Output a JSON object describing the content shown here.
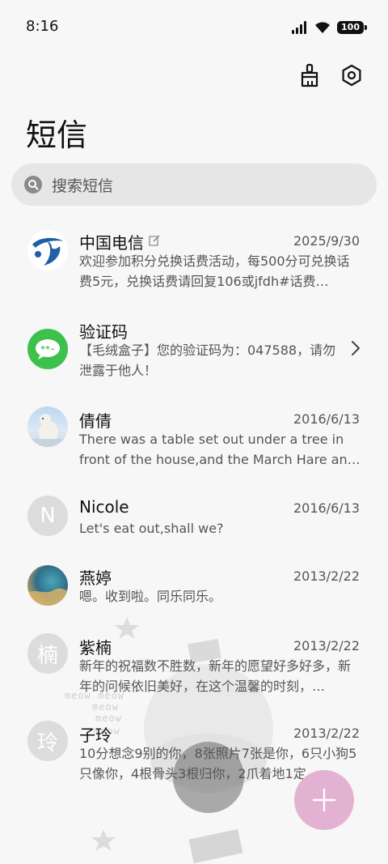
{
  "status_bar": {
    "time": "8:16",
    "battery": "100"
  },
  "header": {
    "title": "短信"
  },
  "search": {
    "placeholder": "搜索短信"
  },
  "conversations": [
    {
      "name": "中国电信",
      "date": "2025/9/30",
      "preview": "欢迎参加积分兑换话费活动，每500分可兑换话费5元，兑换话费请回复106或jfdh#话费…",
      "avatar": "telecom-logo"
    },
    {
      "name": "验证码",
      "date": "",
      "preview": "【毛绒盒子】您的验证码为：047588，请勿泄露于他人！",
      "avatar": "message-bubble"
    },
    {
      "name": "倩倩",
      "date": "2016/6/13",
      "preview": "There was a table set out under a tree in front of the house,and the March Hare an…",
      "avatar": "polar-bear-photo"
    },
    {
      "name": "Nicole",
      "date": "2016/6/13",
      "preview": "Let's eat out,shall we?",
      "avatar_letter": "N"
    },
    {
      "name": "燕婷",
      "date": "2013/2/22",
      "preview": "嗯。收到啦。同乐同乐。",
      "avatar": "landscape-photo"
    },
    {
      "name": "紫楠",
      "date": "2013/2/22",
      "preview": "新年的祝福数不胜数，新年的愿望好多好多，新年的问候依旧美好，在这个温馨的时刻，…",
      "avatar_letter": "楠"
    },
    {
      "name": "子玲",
      "date": "2013/2/22",
      "preview": "10分想念9别的你，8张照片7张是你，6只小狗5只像你，4根骨头3根归你，2爪着地1定…",
      "avatar_letter": "玲"
    }
  ],
  "background_text": [
    "meow meow",
    "meow",
    "meow",
    "meow"
  ],
  "colors": {
    "fab": "#e3b2d3",
    "accent_green": "#3cc14d",
    "telecom_blue": "#1f5fa8"
  }
}
